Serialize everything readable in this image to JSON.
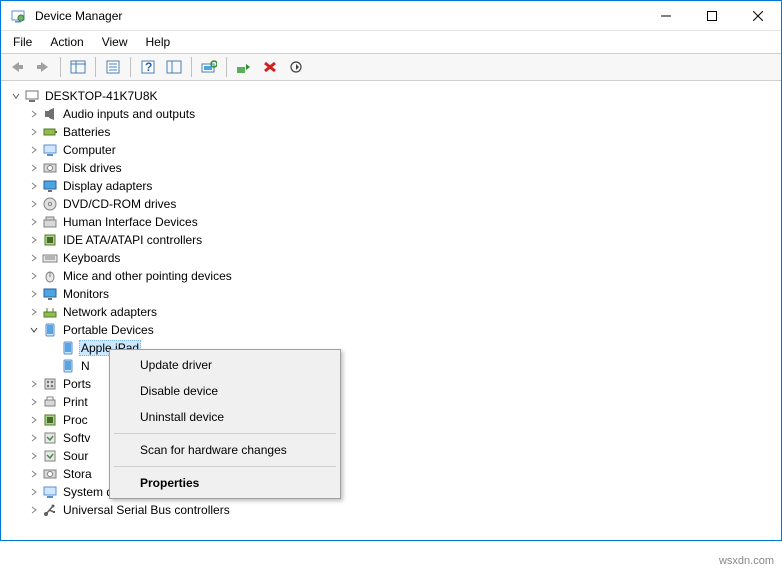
{
  "window": {
    "title": "Device Manager"
  },
  "menubar": [
    "File",
    "Action",
    "View",
    "Help"
  ],
  "tree": {
    "root": "DESKTOP-41K7U8K",
    "items": [
      {
        "label": "Audio inputs and outputs"
      },
      {
        "label": "Batteries"
      },
      {
        "label": "Computer"
      },
      {
        "label": "Disk drives"
      },
      {
        "label": "Display adapters"
      },
      {
        "label": "DVD/CD-ROM drives"
      },
      {
        "label": "Human Interface Devices"
      },
      {
        "label": "IDE ATA/ATAPI controllers"
      },
      {
        "label": "Keyboards"
      },
      {
        "label": "Mice and other pointing devices"
      },
      {
        "label": "Monitors"
      },
      {
        "label": "Network adapters"
      },
      {
        "label": "Portable Devices",
        "expanded": true,
        "children": [
          {
            "label": "Apple iPad",
            "selected": true
          },
          {
            "label": "N"
          }
        ]
      },
      {
        "label": "Ports"
      },
      {
        "label": "Print"
      },
      {
        "label": "Proc"
      },
      {
        "label": "Softv"
      },
      {
        "label": "Sour"
      },
      {
        "label": "Stora"
      },
      {
        "label": "System devices"
      },
      {
        "label": "Universal Serial Bus controllers"
      }
    ]
  },
  "context_menu": {
    "items": [
      {
        "label": "Update driver"
      },
      {
        "label": "Disable device"
      },
      {
        "label": "Uninstall device"
      },
      {
        "sep": true
      },
      {
        "label": "Scan for hardware changes"
      },
      {
        "sep": true
      },
      {
        "label": "Properties",
        "bold": true
      }
    ]
  },
  "watermark": "wsxdn.com"
}
